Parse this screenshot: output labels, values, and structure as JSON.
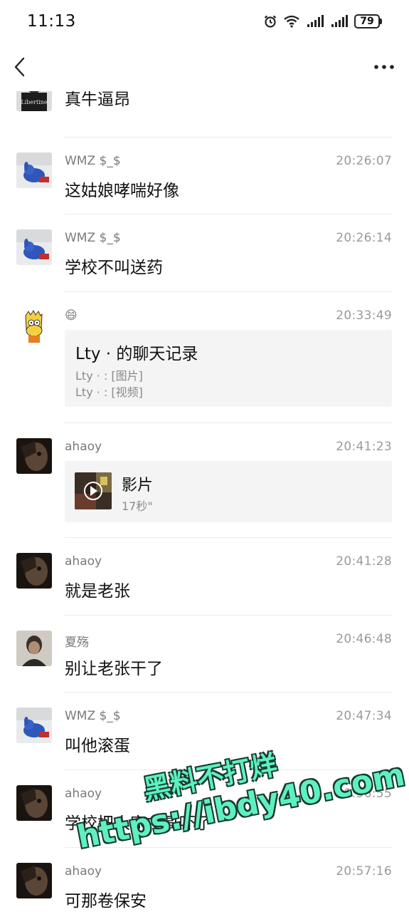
{
  "status": {
    "time": "11:13",
    "battery": "79",
    "icons": [
      "alarm-icon",
      "wifi-icon",
      "signal-icon",
      "signal-icon"
    ]
  },
  "nav": {
    "back_icon": "chevron-left-icon",
    "more_icon": "more-dots-icon"
  },
  "messages": [
    {
      "sender": "",
      "time": "",
      "text": "真牛逼昂"
    },
    {
      "sender": "WMZ $_$",
      "time": "20:26:07",
      "text": "这姑娘哮喘好像"
    },
    {
      "sender": "WMZ $_$",
      "time": "20:26:14",
      "text": "学校不叫送药"
    },
    {
      "sender": "😄",
      "time": "20:33:49",
      "card": {
        "title": "Lty · 的聊天记录",
        "lines": [
          "Lty · : [图片]",
          "Lty · : [视频]"
        ]
      }
    },
    {
      "sender": "ahaoy",
      "time": "20:41:23",
      "video": {
        "title": "影片",
        "duration": "17秒\""
      }
    },
    {
      "sender": "ahaoy",
      "time": "20:41:28",
      "text": "就是老张"
    },
    {
      "sender": "夏殇",
      "time": "20:46:48",
      "text": "别让老张干了"
    },
    {
      "sender": "WMZ $_$",
      "time": "20:47:34",
      "text": "叫他滚蛋"
    },
    {
      "sender": "ahaoy",
      "time": "20:56:55",
      "text": "学校把人家中哥吓了"
    },
    {
      "sender": "ahaoy",
      "time": "20:57:16",
      "text": "可那卷保安"
    }
  ],
  "watermark": {
    "line1": "黑料不打烊",
    "line2": "https://ibdy40.com"
  },
  "colors": {
    "background": "#ffffff",
    "sender": "#7a7a7a",
    "time": "#9a9a9a",
    "card": "#f4f4f4",
    "watermark": "#5ef0c0"
  }
}
